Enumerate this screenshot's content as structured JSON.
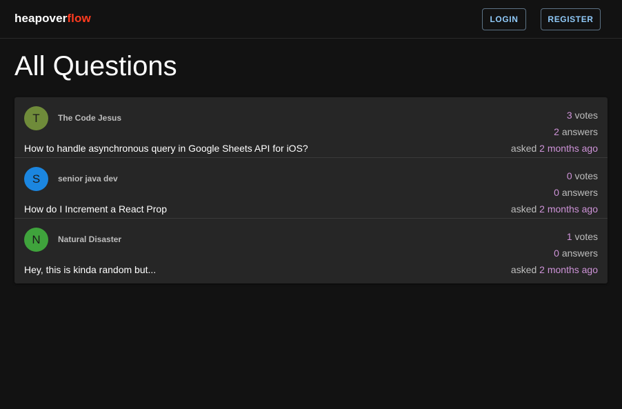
{
  "header": {
    "brand_part1": "heapover",
    "brand_part2": "flow",
    "login_label": "LOGIN",
    "register_label": "REGISTER"
  },
  "page": {
    "title": "All Questions"
  },
  "colors": {
    "accent_brand": "#ff3b1f",
    "button_text": "#90caf9",
    "stat_highlight": "#ce93d8"
  },
  "questions": [
    {
      "avatar_letter": "T",
      "avatar_color": "#6f8b3a",
      "author": "The Code Jesus",
      "title": "How to handle asynchronous query in Google Sheets API for iOS?",
      "votes": "3",
      "votes_label": "votes",
      "answers": "2",
      "answers_label": "answers",
      "asked_prefix": "asked",
      "asked_time": "2 months ago"
    },
    {
      "avatar_letter": "S",
      "avatar_color": "#1b86e0",
      "author": "senior java dev",
      "title": "How do I Increment a React Prop",
      "votes": "0",
      "votes_label": "votes",
      "answers": "0",
      "answers_label": "answers",
      "asked_prefix": "asked",
      "asked_time": "2 months ago"
    },
    {
      "avatar_letter": "N",
      "avatar_color": "#3fa33c",
      "author": "Natural Disaster",
      "title": "Hey, this is kinda random but...",
      "votes": "1",
      "votes_label": "votes",
      "answers": "0",
      "answers_label": "answers",
      "asked_prefix": "asked",
      "asked_time": "2 months ago"
    }
  ]
}
